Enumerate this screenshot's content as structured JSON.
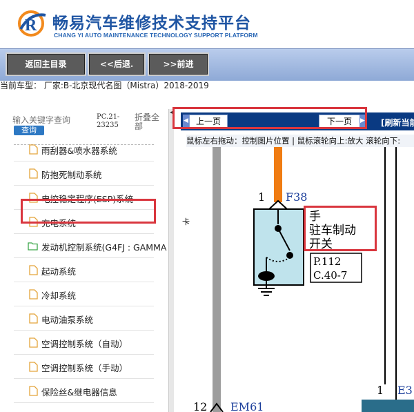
{
  "header": {
    "title": "畅易汽车维修技术支持平台",
    "subtitle": "CHANG YI AUTO MAINTENANCE TECHNOLOGY SUPPORT PLATFORM"
  },
  "nav": {
    "back_main": "返回主目录",
    "back": "<<后退.",
    "forward": ">>前进"
  },
  "status": {
    "current_model": "当前车型：  厂家:B-北京现代名图（Mistra）2018-2019"
  },
  "sidebar": {
    "search_placeholder": "输入关键字查询",
    "search_button": "查询",
    "pc_code": "PC.21-23235",
    "collapse_all": "折叠全部",
    "items": [
      {
        "label": "雨刮器&喷水器系统",
        "icon": "file-icon"
      },
      {
        "label": "防抱死制动系统",
        "icon": "file-icon"
      },
      {
        "label": "电控稳定程序(ESP)系统",
        "icon": "file-icon"
      },
      {
        "label": "充电系统",
        "icon": "file-icon"
      },
      {
        "label": "发动机控制系统(G4FJ : GAMMA",
        "icon": "folder-icon"
      },
      {
        "label": "起动系统",
        "icon": "file-icon"
      },
      {
        "label": "冷却系统",
        "icon": "file-icon"
      },
      {
        "label": "电动油泵系统",
        "icon": "file-icon"
      },
      {
        "label": "空调控制系统（自动）",
        "icon": "file-icon"
      },
      {
        "label": "空调控制系统（手动）",
        "icon": "file-icon"
      },
      {
        "label": "保险丝&继电器信息",
        "icon": "file-icon"
      }
    ]
  },
  "diagram": {
    "prev_page": "上一页",
    "next_page": "下一页",
    "refresh": "[刷新当前",
    "hint": "鼠标左右拖动：控制图片位置 | 鼠标滚轮向上:放大  滚轮向下:",
    "connector_f38": "F38",
    "pin_1": "1",
    "switch_label_1": "手",
    "switch_label_2": "驻车制动",
    "switch_label_3": "开关",
    "ref_page": "P.112",
    "ref_c": "C.40-7",
    "pin_12": "12",
    "connector_em61": "EM61",
    "pin_1b": "1",
    "connector_e3": "E3",
    "side_mark": "卡"
  },
  "colors": {
    "brand_blue": "#1f55a3",
    "nav_button": "#5b5b5b",
    "pager_bar": "#0a3a82",
    "highlight_red": "#d9363e",
    "wire_orange": "#f07c12",
    "switch_fill": "#bfe3ec"
  }
}
